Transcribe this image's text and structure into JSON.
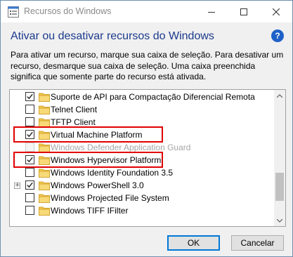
{
  "window": {
    "title": "Recursos do Windows"
  },
  "header": {
    "title": "Ativar ou desativar recursos do Windows",
    "help_label": "?"
  },
  "description": "Para ativar um recurso, marque sua caixa de seleção. Para desativar um recurso, desmarque sua caixa de seleção. Uma caixa preenchida significa que somente parte do recurso está ativada.",
  "features": [
    {
      "label": "Suporte de API para Compactação Diferencial Remota",
      "state": "checked",
      "enabled": true,
      "expandable": false
    },
    {
      "label": "Telnet Client",
      "state": "unchecked",
      "enabled": true,
      "expandable": false
    },
    {
      "label": "TFTP Client",
      "state": "unchecked",
      "enabled": true,
      "expandable": false
    },
    {
      "label": "Virtual Machine Platform",
      "state": "checked",
      "enabled": true,
      "expandable": false,
      "highlighted": true
    },
    {
      "label": "Windows Defender Application Guard",
      "state": "unchecked",
      "enabled": false,
      "expandable": false
    },
    {
      "label": "Windows Hypervisor Platform",
      "state": "checked",
      "enabled": true,
      "expandable": false,
      "highlighted": true
    },
    {
      "label": "Windows Identity Foundation 3.5",
      "state": "unchecked",
      "enabled": true,
      "expandable": false
    },
    {
      "label": "Windows PowerShell 3.0",
      "state": "checked",
      "enabled": true,
      "expandable": true
    },
    {
      "label": "Windows Projected File System",
      "state": "unchecked",
      "enabled": true,
      "expandable": false
    },
    {
      "label": "Windows TIFF IFilter",
      "state": "unchecked",
      "enabled": true,
      "expandable": false
    }
  ],
  "buttons": {
    "ok_label": "OK",
    "cancel_label": "Cancelar"
  },
  "colors": {
    "highlight": "#e00000",
    "heading": "#1b3a8c",
    "folder": "#f2c94c"
  }
}
